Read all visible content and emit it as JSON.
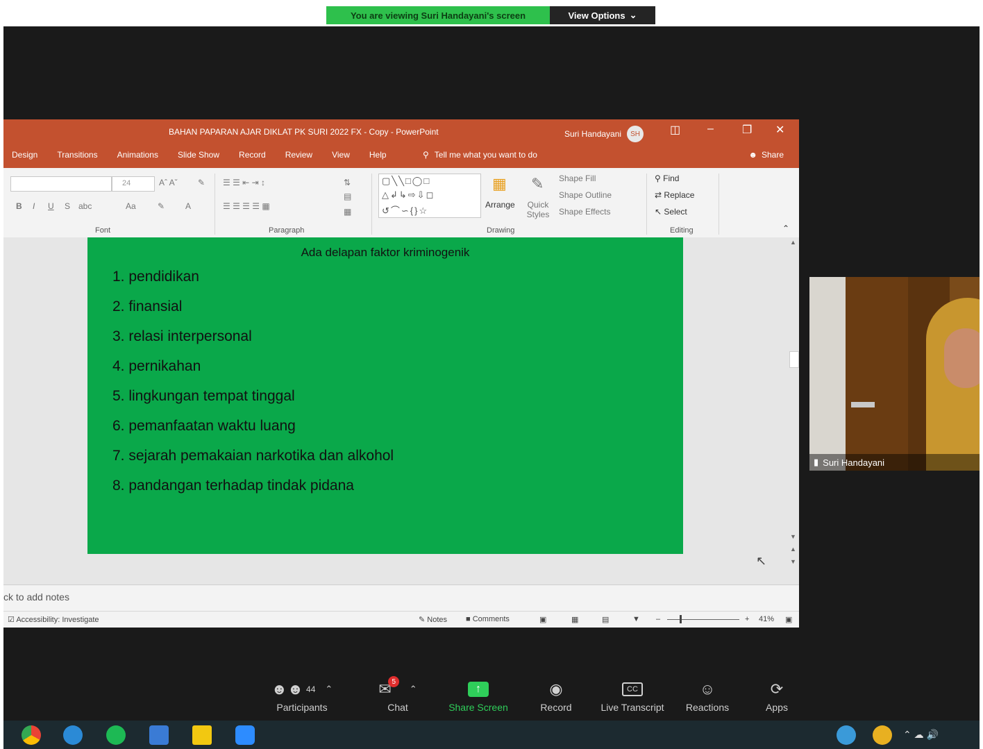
{
  "zoom_banner": {
    "viewing_text": "You are viewing Suri Handayani's screen",
    "view_options_label": "View Options"
  },
  "ppt": {
    "title": "BAHAN PAPARAN AJAR DIKLAT PK SURI 2022 FX - Copy - PowerPoint",
    "user_name": "Suri Handayani",
    "user_initials": "SH",
    "tabs": [
      "Design",
      "Transitions",
      "Animations",
      "Slide Show",
      "Record",
      "Review",
      "View",
      "Help"
    ],
    "tell_me": "Tell me what you want to do",
    "share_label": "Share",
    "ribbon": {
      "font_size": "24",
      "font_group": "Font",
      "paragraph_group": "Paragraph",
      "drawing_group": "Drawing",
      "editing_group": "Editing",
      "arrange": "Arrange",
      "quick_styles": "Quick Styles",
      "shape_fill": "Shape Fill",
      "shape_outline": "Shape Outline",
      "shape_effects": "Shape Effects",
      "find": "Find",
      "replace": "Replace",
      "select": "Select"
    },
    "slide": {
      "title": "Ada delapan faktor kriminogenik",
      "items": [
        "1. pendidikan",
        "2. finansial",
        "3. relasi interpersonal",
        "4. pernikahan",
        "5. lingkungan tempat tinggal",
        "6. pemanfaatan waktu luang",
        "7. sejarah pemakaian narkotika dan alkohol",
        "8. pandangan terhadap tindak pidana"
      ]
    },
    "notes_placeholder": "ck to add notes",
    "status": {
      "accessibility": "Accessibility: Investigate",
      "notes": "Notes",
      "comments": "Comments",
      "zoom": "41%"
    }
  },
  "participant_video": {
    "name": "Suri Handayani"
  },
  "zoom_toolbar": {
    "participants_label": "Participants",
    "participants_count": "44",
    "chat_label": "Chat",
    "chat_badge": "5",
    "share_screen_label": "Share Screen",
    "record_label": "Record",
    "live_transcript_label": "Live Transcript",
    "reactions_label": "Reactions",
    "apps_label": "Apps"
  },
  "colors": {
    "ppt_accent": "#c3512f",
    "slide_bg": "#0aa84a",
    "zoom_green": "#2ec04c"
  }
}
